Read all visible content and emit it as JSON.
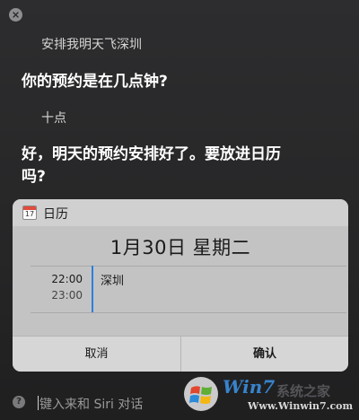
{
  "conversation": {
    "user_1": "安排我明天飞深圳",
    "siri_1": "你的预约是在几点钟?",
    "user_2": "十点",
    "siri_2": "好，明天的预约安排好了。要放进日历吗?"
  },
  "calendar_card": {
    "app_name": "日历",
    "icon_day": "17",
    "date_title": "1月30日 星期二",
    "event": {
      "start_time": "22:00",
      "end_time": "23:00",
      "title": "深圳",
      "color": "#2b7fe0"
    },
    "cancel_label": "取消",
    "confirm_label": "确认"
  },
  "input": {
    "placeholder": "键入来和 Siri 对话",
    "help_icon": "?"
  },
  "watermark": {
    "brand": "Win7",
    "subtitle": "系统之家",
    "url": "Www.Winwin7.com"
  }
}
